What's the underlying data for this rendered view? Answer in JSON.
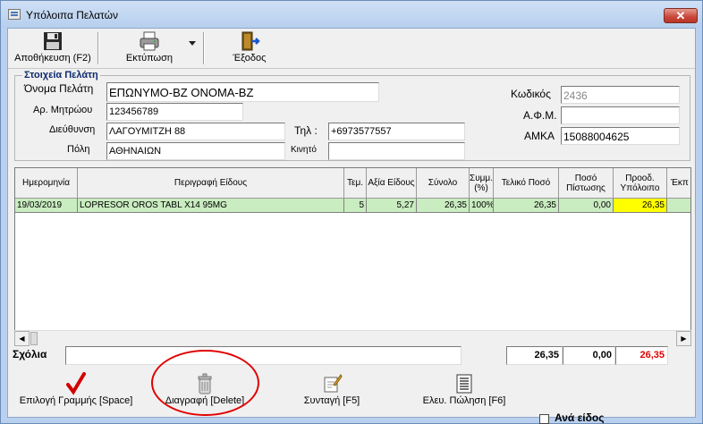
{
  "window": {
    "title": "Υπόλοιπα Πελατών",
    "close_label": "✕"
  },
  "toolbar": {
    "save_label": "Αποθήκευση (F2)",
    "print_label": "Εκτύπωση",
    "exit_label": "Έξοδος"
  },
  "customer": {
    "group_label": "Στοιχεία Πελάτη",
    "name_label": "Όνομα Πελάτη",
    "name_value": "ΕΠΩΝΥΜΟ-BZ ONOMA-BZ",
    "reg_label": "Αρ. Μητρώου",
    "reg_value": "123456789",
    "address_label": "Διεύθυνση",
    "address_value": "ΛΑΓΟΥΜΙΤΖΗ 88",
    "phone_label": "Τηλ :",
    "phone_value": "+6973577557",
    "city_label": "Πόλη",
    "city_value": "ΑΘΗΝΑΙΩΝ",
    "mobile_label": "Κινητό",
    "mobile_value": "",
    "code_label": "Κωδικός",
    "code_value": "2436",
    "afm_label": "Α.Φ.Μ.",
    "afm_value": "",
    "amka_label": "ΑΜΚΑ",
    "amka_value": "15088004625"
  },
  "table": {
    "headers": [
      "Ημερομηνία",
      "Περιγραφή Είδους",
      "Τεμ.",
      "Αξία Είδους",
      "Σύνολο",
      "Συμμ. (%)",
      "Τελικό Ποσό",
      "Ποσό Πίστωσης",
      "Προοδ. Υπόλοιπο",
      "Έκπ"
    ],
    "rows": [
      {
        "date": "19/03/2019",
        "description": "LOPRESOR OROS TABL X14 95MG",
        "qty": "5",
        "value": "5,27",
        "total": "26,35",
        "share": "100%",
        "final": "26,35",
        "credit": "0,00",
        "balance": "26,35"
      }
    ]
  },
  "footer": {
    "comments_label": "Σχόλια",
    "comments_value": "",
    "total_final": "26,35",
    "total_credit": "0,00",
    "total_balance": "26,35",
    "balance_color": "#e00000"
  },
  "actions": {
    "select_label": "Επιλογή Γραμμής [Space]",
    "delete_label": "Διαγραφή [Delete]",
    "prescription_label": "Συνταγή [F5]",
    "free_sale_label": "Ελευ. Πώληση [F6]",
    "per_item_label": "Ανά είδος"
  },
  "colors": {
    "selected_row": "#c9ecc0",
    "balance_highlight": "#ffff00",
    "annotation": "#e10000"
  }
}
